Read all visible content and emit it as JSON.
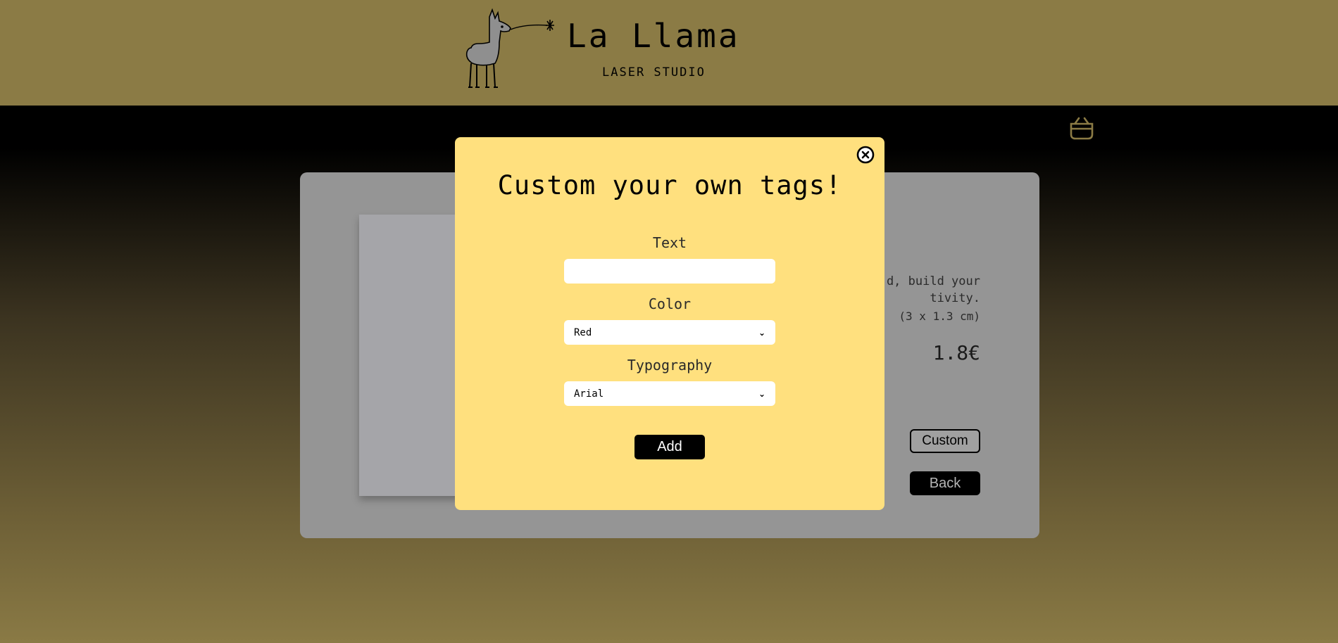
{
  "brand": {
    "title": "La Llama",
    "subtitle": "LASER STUDIO",
    "logo_icon": "llama-laser-icon"
  },
  "header": {
    "background": "#8b7b45"
  },
  "cart": {
    "icon": "shopping-basket-icon",
    "color": "#8b7b45"
  },
  "product": {
    "description": "d, build your tivity.",
    "description_lines": [
      "d, build your",
      "tivity."
    ],
    "size": "(3 x 1.3 cm)",
    "price": "1.8€",
    "custom_label": "Custom",
    "back_label": "Back"
  },
  "modal": {
    "title": "Custom your own tags!",
    "close_icon": "close-circle-icon",
    "background": "#ffe07e",
    "text_label": "Text",
    "text_value": "",
    "color_label": "Color",
    "color_selected": "Red",
    "typography_label": "Typography",
    "typography_selected": "Arial",
    "add_label": "Add"
  }
}
